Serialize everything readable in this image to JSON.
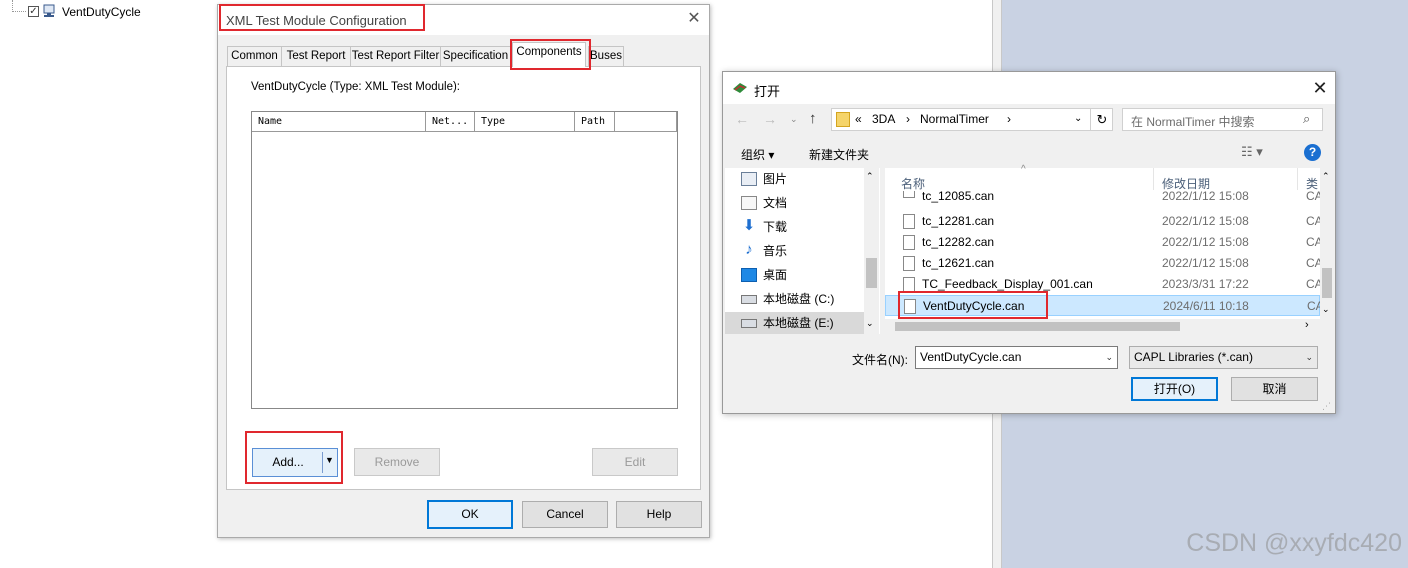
{
  "tree": {
    "item_label": "VentDutyCycle"
  },
  "xml_dialog": {
    "title": "XML Test Module Configuration",
    "close_glyph": "✕",
    "tabs": [
      "Common",
      "Test Report",
      "Test Report Filter",
      "Specification",
      "Components",
      "Buses"
    ],
    "active_tab": "Components",
    "caption": "VentDutyCycle (Type: XML Test Module):",
    "columns": [
      "Name",
      "Net...",
      "Type",
      "Path"
    ],
    "buttons": {
      "add": "Add...",
      "remove": "Remove",
      "edit": "Edit",
      "ok": "OK",
      "cancel": "Cancel",
      "help": "Help"
    }
  },
  "open_dialog": {
    "title": "打开",
    "close_glyph": "✕",
    "breadcrumb": [
      "«",
      "3DA",
      "NormalTimer"
    ],
    "search_placeholder": "在 NormalTimer 中搜索",
    "toolbar": {
      "organize": "组织 ▾",
      "new_folder": "新建文件夹"
    },
    "nav_items": [
      {
        "label": "图片",
        "icon": "pictures-icon"
      },
      {
        "label": "文档",
        "icon": "documents-icon"
      },
      {
        "label": "下载",
        "icon": "downloads-icon"
      },
      {
        "label": "音乐",
        "icon": "music-icon"
      },
      {
        "label": "桌面",
        "icon": "desktop-icon"
      },
      {
        "label": "本地磁盘 (C:)",
        "icon": "drive-c-icon"
      },
      {
        "label": "本地磁盘 (E:)",
        "icon": "drive-e-icon"
      }
    ],
    "columns": {
      "name": "名称",
      "date": "修改日期",
      "type": "类"
    },
    "files": [
      {
        "name": "tc_12085.can",
        "date": "2022/1/12 15:08",
        "type": "CA"
      },
      {
        "name": "tc_12281.can",
        "date": "2022/1/12 15:08",
        "type": "CA"
      },
      {
        "name": "tc_12282.can",
        "date": "2022/1/12 15:08",
        "type": "CA"
      },
      {
        "name": "tc_12621.can",
        "date": "2022/1/12 15:08",
        "type": "CA"
      },
      {
        "name": "TC_Feedback_Display_001.can",
        "date": "2023/3/31 17:22",
        "type": "CA"
      },
      {
        "name": "VentDutyCycle.can",
        "date": "2024/6/11 10:18",
        "type": "CA"
      }
    ],
    "selected_file": "VentDutyCycle.can",
    "filename_label": "文件名(N):",
    "filename_value": "VentDutyCycle.can",
    "filter_value": "CAPL Libraries (*.can)",
    "open_button": "打开(O)",
    "cancel_button": "取消"
  },
  "watermark": "CSDN @xxyfdc420",
  "colors": {
    "highlight_red": "#e0282e",
    "selection_blue": "#cce8ff",
    "accent": "#0078d7",
    "right_panel": "#c9d2e3"
  }
}
